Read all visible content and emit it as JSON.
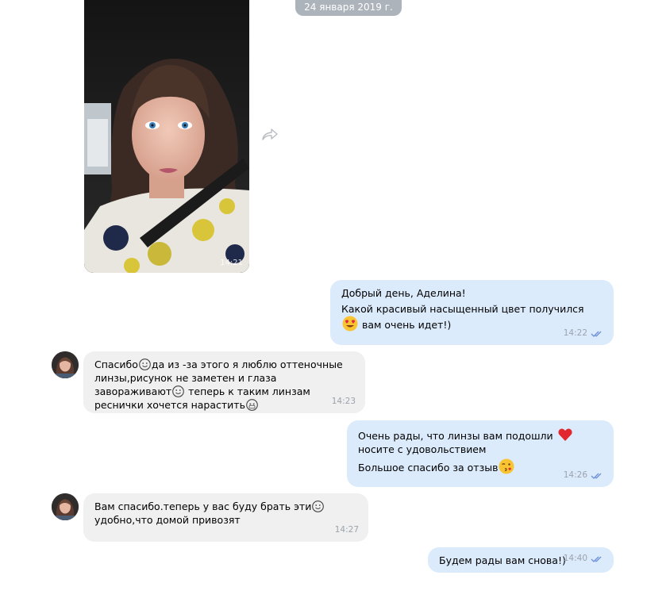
{
  "date_label": "24 января 2019 г.",
  "photo": {
    "time": "14:21"
  },
  "messages": [
    {
      "direction": "out",
      "lines": [
        "Добрый день, Аделина!",
        "Какой красивый насыщенный цвет получился",
        "вам очень идет!)"
      ],
      "emoji": "heart-eyes-emoji",
      "time": "14:22",
      "status": "read"
    },
    {
      "direction": "in",
      "parts": [
        "Спасибо",
        "да из -за этого я люблю оттеночные линзы,рисунок не заметен и глаза завораживают",
        "теперь к таким линзам реснички хочется нарастить"
      ],
      "time": "14:23"
    },
    {
      "direction": "out",
      "parts": [
        "Очень рады, что линзы вам подошли",
        "носите с удовольствием",
        "Большое спасибо за отзыв"
      ],
      "emoji": [
        "red-heart-emoji",
        "kiss-wink-emoji"
      ],
      "time": "14:26",
      "status": "read"
    },
    {
      "direction": "in",
      "parts": [
        "Вам спасибо.теперь у вас буду брать эти",
        "удобно,что домой привозят"
      ],
      "time": "14:27"
    },
    {
      "direction": "out",
      "lines": [
        "Будем рады вам снова!)"
      ],
      "time": "14:40",
      "status": "read"
    }
  ],
  "colors": {
    "outgoing_bubble": "#dbebfc",
    "incoming_bubble": "#f0f0f0",
    "date_pill": "#adb3bb",
    "read_check": "#6b8fd6"
  }
}
